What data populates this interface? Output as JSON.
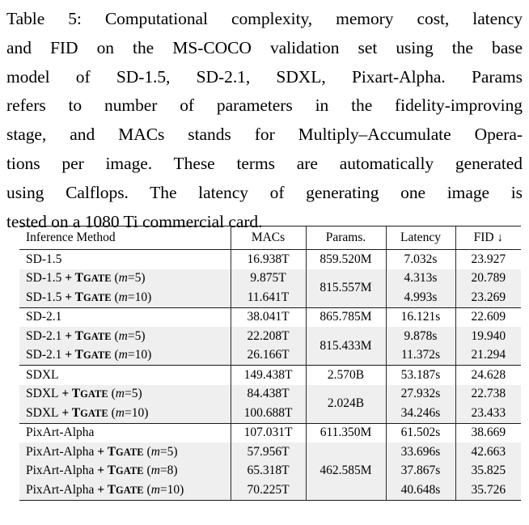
{
  "caption": {
    "lines": [
      "Table 5: Computational complexity, memory cost, latency",
      "and FID on the MS-COCO validation set using the base",
      "model of SD-1.5, SD-2.1, SDXL, Pixart-Alpha.  Params",
      "refers to number of parameters in the fidelity-improving",
      "stage, and MACs stands for Multiply–Accumulate Opera-",
      "tions per image.  These terms are automatically generated",
      "using Calflops.  The latency of generating one image is",
      "tested on a 1080 Ti commercial card."
    ],
    "label": "Table 5",
    "full_text": "Table 5: Computational complexity, memory cost, latency and FID on the MS-COCO validation set using the base model of SD-1.5, SD-2.1, SDXL, Pixart-Alpha. Params refers to number of parameters in the fidelity-improving stage, and MACs stands for Multiply–Accumulate Operations per image. These terms are automatically generated using Calflops. The latency of generating one image is tested on a 1080 Ti commercial card."
  },
  "table": {
    "headers": {
      "method": "Inference Method",
      "macs": "MACs",
      "params": "Params.",
      "latency": "Latency",
      "fid": "FID",
      "fid_arrow": "↓"
    },
    "shade_color": "#efefef",
    "blocks": [
      {
        "id": "sd15",
        "params_merged": "815.557M",
        "params_merged_bold": true,
        "rows": [
          {
            "method_prefix": "SD-1.5",
            "has_tgate": false,
            "m": null,
            "shaded": false,
            "macs": "16.938T",
            "macs_bold": false,
            "params": "859.520M",
            "params_bold": false,
            "latency": "7.032s",
            "latency_bold": false,
            "fid": "23.927",
            "fid_bold": false
          },
          {
            "method_prefix": "SD-1.5",
            "has_tgate": true,
            "m": "5",
            "shaded": true,
            "macs": "9.875T",
            "macs_bold": true,
            "params": null,
            "params_bold": true,
            "latency": "4.313s",
            "latency_bold": true,
            "fid": "20.789",
            "fid_bold": true
          },
          {
            "method_prefix": "SD-1.5",
            "has_tgate": true,
            "m": "10",
            "shaded": true,
            "macs": "11.641T",
            "macs_bold": false,
            "params": null,
            "params_bold": false,
            "latency": "4.993s",
            "latency_bold": false,
            "fid": "23.269",
            "fid_bold": false
          }
        ]
      },
      {
        "id": "sd21",
        "params_merged": "815.433M",
        "params_merged_bold": true,
        "rows": [
          {
            "method_prefix": "SD-2.1",
            "has_tgate": false,
            "m": null,
            "shaded": false,
            "macs": "38.041T",
            "macs_bold": false,
            "params": "865.785M",
            "params_bold": false,
            "latency": "16.121s",
            "latency_bold": false,
            "fid": "22.609",
            "fid_bold": false
          },
          {
            "method_prefix": "SD-2.1",
            "has_tgate": true,
            "m": "5",
            "shaded": true,
            "macs": "22.208T",
            "macs_bold": true,
            "params": null,
            "params_bold": true,
            "latency": "9.878s",
            "latency_bold": true,
            "fid": "19.940",
            "fid_bold": true
          },
          {
            "method_prefix": "SD-2.1",
            "has_tgate": true,
            "m": "10",
            "shaded": true,
            "macs": "26.166T",
            "macs_bold": false,
            "params": null,
            "params_bold": false,
            "latency": "11.372s",
            "latency_bold": false,
            "fid": "21.294",
            "fid_bold": false
          }
        ]
      },
      {
        "id": "sdxl",
        "params_merged": "2.024B",
        "params_merged_bold": true,
        "rows": [
          {
            "method_prefix": "SDXL",
            "has_tgate": false,
            "m": null,
            "shaded": false,
            "macs": "149.438T",
            "macs_bold": false,
            "params": "2.570B",
            "params_bold": false,
            "latency": "53.187s",
            "latency_bold": false,
            "fid": "24.628",
            "fid_bold": false
          },
          {
            "method_prefix": "SDXL",
            "has_tgate": true,
            "m": "5",
            "shaded": true,
            "macs": "84.438T",
            "macs_bold": true,
            "params": null,
            "params_bold": true,
            "latency": "27.932s",
            "latency_bold": true,
            "fid": "22.738",
            "fid_bold": true
          },
          {
            "method_prefix": "SDXL",
            "has_tgate": true,
            "m": "10",
            "shaded": true,
            "macs": "100.688T",
            "macs_bold": false,
            "params": null,
            "params_bold": false,
            "latency": "34.246s",
            "latency_bold": false,
            "fid": "23.433",
            "fid_bold": false
          }
        ]
      },
      {
        "id": "pixart",
        "params_merged": "462.585M",
        "params_merged_bold": true,
        "rows": [
          {
            "method_prefix": "PixArt-Alpha",
            "has_tgate": false,
            "m": null,
            "shaded": false,
            "macs": "107.031T",
            "macs_bold": false,
            "params": "611.350M",
            "params_bold": false,
            "latency": "61.502s",
            "latency_bold": false,
            "fid": "38.669",
            "fid_bold": false
          },
          {
            "method_prefix": "PixArt-Alpha",
            "has_tgate": true,
            "m": "5",
            "shaded": true,
            "macs": "57.956T",
            "macs_bold": true,
            "params": null,
            "params_bold": false,
            "latency": "33.696s",
            "latency_bold": true,
            "fid": "42.663",
            "fid_bold": false
          },
          {
            "method_prefix": "PixArt-Alpha",
            "has_tgate": true,
            "m": "8",
            "shaded": true,
            "macs": "65.318T",
            "macs_bold": false,
            "params": null,
            "params_bold": true,
            "latency": "37.867s",
            "latency_bold": false,
            "fid": "35.825",
            "fid_bold": false
          },
          {
            "method_prefix": "PixArt-Alpha",
            "has_tgate": true,
            "m": "10",
            "shaded": true,
            "macs": "70.225T",
            "macs_bold": false,
            "params": null,
            "params_bold": false,
            "latency": "40.648s",
            "latency_bold": false,
            "fid": "35.726",
            "fid_bold": true
          }
        ]
      }
    ],
    "tgate_label": {
      "big": "T",
      "small": "GATE"
    },
    "plus_sign": "+"
  }
}
